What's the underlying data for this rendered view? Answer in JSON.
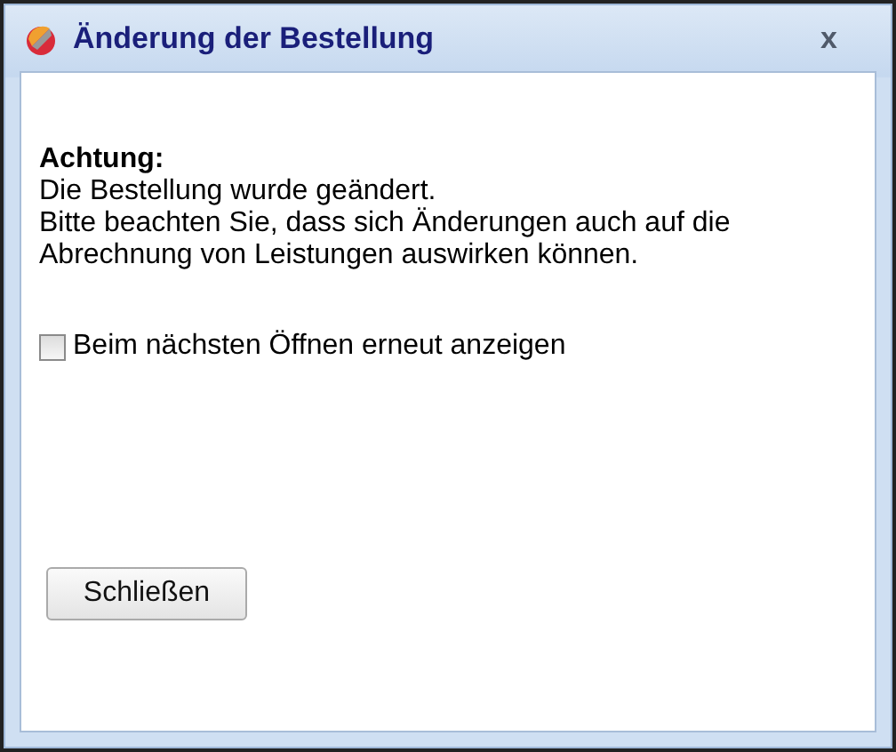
{
  "window": {
    "title": "Änderung der Bestellung",
    "close": "x"
  },
  "message": {
    "heading": "Achtung:",
    "lines": [
      "Die Bestellung wurde geändert.",
      "Bitte beachten Sie, dass sich Änderungen auch auf die Abrechnung von Leistungen auswirken können."
    ]
  },
  "checkbox": {
    "label": "Beim nächsten Öffnen erneut anzeigen",
    "checked": false
  },
  "buttons": [
    "Schließen"
  ]
}
